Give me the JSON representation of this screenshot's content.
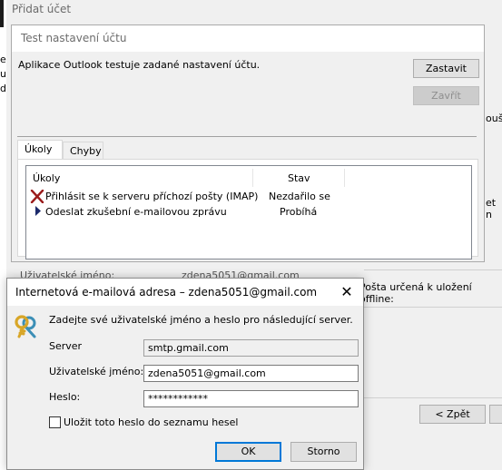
{
  "background_window": {
    "title": "Přidat účet",
    "left_chars": [
      "e",
      "u",
      "d"
    ],
    "right_fragments": {
      "partial_1": "oušt",
      "partial_2": "et n",
      "offline_label": "Pošta určená k uložení offline:"
    },
    "under_credentials": {
      "username_label": "Uživatelské jméno:",
      "username_value": "zdena5051@gmail.com"
    },
    "back_button": "< Zpět"
  },
  "test_dialog": {
    "title": "Test nastavení účtu",
    "description": "Aplikace Outlook testuje zadané nastavení účtu.",
    "stop_button": "Zastavit",
    "close_button": "Zavřít",
    "tabs": [
      {
        "label": "Úkoly",
        "active": true
      },
      {
        "label": "Chyby",
        "active": false
      }
    ],
    "columns": [
      "Úkoly",
      "Stav"
    ],
    "tasks": [
      {
        "name": "Přihlásit se k serveru příchozí pošty (IMAP)",
        "status": "Nezdařilo se",
        "icon": "x-error-icon"
      },
      {
        "name": "Odeslat zkušební e-mailovou zprávu",
        "status": "Probíhá",
        "icon": "arrow-right-icon"
      }
    ]
  },
  "credentials_dialog": {
    "title": "Internetová e-mailová adresa – zdena5051@gmail.com",
    "prompt": "Zadejte své uživatelské jméno a heslo pro následující server.",
    "server_label": "Server",
    "server_value": "smtp.gmail.com",
    "username_label": "Uživatelské jméno:",
    "username_value": "zdena5051@gmail.com",
    "password_label": "Heslo:",
    "password_value": "************",
    "save_password_label": "Uložit toto heslo do seznamu hesel",
    "save_password_checked": false,
    "ok_button": "OK",
    "cancel_button": "Storno"
  },
  "colors": {
    "error_x": "#9b1c1c",
    "arrow": "#1b2a6b",
    "key_icon": "#d8a628"
  }
}
